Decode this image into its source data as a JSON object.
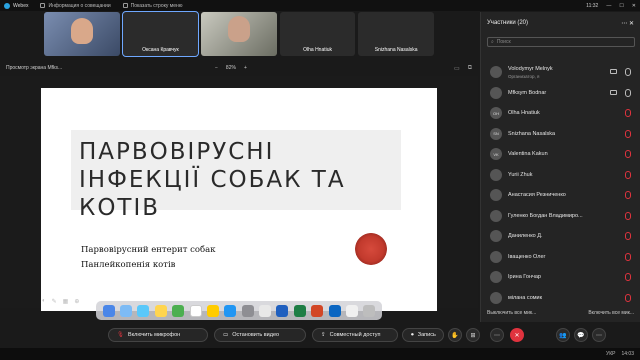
{
  "titlebar": {
    "app_name": "Webex",
    "meeting_info": "Информация о совещании",
    "show_menu": "Показать строку меню",
    "time": "11:32"
  },
  "video_tiles": [
    {
      "name": ""
    },
    {
      "name": "Оксана Кравчук"
    },
    {
      "name": ""
    },
    {
      "name": "Olha Hnatiuk"
    },
    {
      "name": "Snizhana Nasalska"
    }
  ],
  "sharebar": {
    "label": "Просмотр экрана Mfks...",
    "zoom_minus": "−",
    "zoom_value": "82%",
    "zoom_plus": "+"
  },
  "slide": {
    "title": "ПАРВОВІРУСНІ ІНФЕКЦІЇ СОБАК ТА КОТІВ",
    "line1": "Парвовірусний ентерит собак",
    "line2": "Панлейкопенія котів"
  },
  "participants": {
    "header": "Участники (20)",
    "search_placeholder": "Поиск",
    "items": [
      {
        "initials": "",
        "name": "Volodymyr Melnyk",
        "role": "Организатор, я",
        "muted": false,
        "camera": true
      },
      {
        "initials": "",
        "name": "Mfksym Bodnar",
        "role": "",
        "muted": false,
        "camera": true
      },
      {
        "initials": "OH",
        "name": "Olha Hnatiuk",
        "role": "",
        "muted": true,
        "camera": false
      },
      {
        "initials": "SN",
        "name": "Snizhana Nasalska",
        "role": "",
        "muted": true,
        "camera": false
      },
      {
        "initials": "VK",
        "name": "Valentina Kakun",
        "role": "",
        "muted": true,
        "camera": false
      },
      {
        "initials": "",
        "name": "Yurii Zhuk",
        "role": "",
        "muted": true,
        "camera": false
      },
      {
        "initials": "",
        "name": "Анастасия Резниченко",
        "role": "",
        "muted": true,
        "camera": false
      },
      {
        "initials": "",
        "name": "Гуленко Богдан Владимиро...",
        "role": "",
        "muted": true,
        "camera": false
      },
      {
        "initials": "",
        "name": "Даниленко Д.",
        "role": "",
        "muted": true,
        "camera": false
      },
      {
        "initials": "",
        "name": "Іващенко Олег",
        "role": "",
        "muted": true,
        "camera": false
      },
      {
        "initials": "",
        "name": "Ірина Гончар",
        "role": "",
        "muted": true,
        "camera": false
      },
      {
        "initials": "",
        "name": "мілана сомик",
        "role": "",
        "muted": true,
        "camera": false
      }
    ],
    "mute_all": "Выключить все мик...",
    "unmute_all": "Включить все мик..."
  },
  "controls": {
    "mic": "Включить микрофон",
    "video": "Остановить видео",
    "share": "Совместный доступ",
    "record": "Запись"
  },
  "taskbar": {
    "lang": "УКР",
    "time": "14:03"
  },
  "colors": {
    "accent": "#2aa3e0",
    "end_call": "#e0333e",
    "muted": "#e0333e"
  }
}
